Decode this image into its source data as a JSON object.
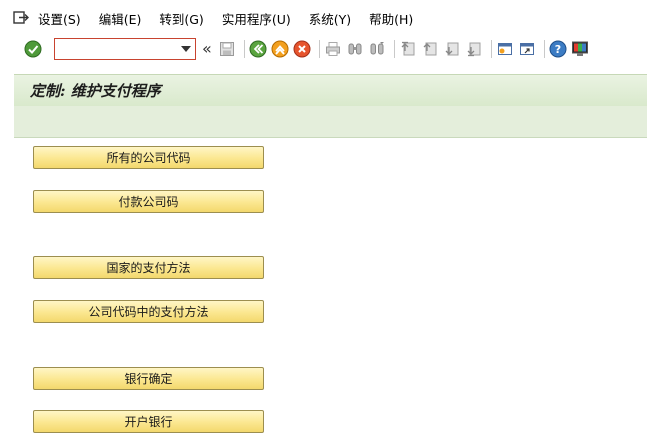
{
  "menu": {
    "items": [
      {
        "label": "设置(S)"
      },
      {
        "label": "编辑(E)"
      },
      {
        "label": "转到(G)"
      },
      {
        "label": "实用程序(U)"
      },
      {
        "label": "系统(Y)"
      },
      {
        "label": "帮助(H)"
      }
    ]
  },
  "toolbar": {
    "command_value": "",
    "icons": [
      "enter-check-icon",
      "command-dropdown-icon",
      "double-chevron-left-icon",
      "save-icon",
      "back-icon",
      "exit-icon",
      "cancel-icon",
      "print-icon",
      "find-icon",
      "find-next-icon",
      "first-page-icon",
      "previous-page-icon",
      "next-page-icon",
      "last-page-icon",
      "create-session-icon",
      "shortcut-icon",
      "help-icon",
      "customize-layout-icon"
    ]
  },
  "title": "定制: 维护支付程序",
  "buttons": [
    {
      "label": "所有的公司代码"
    },
    {
      "label": "付款公司码"
    },
    {
      "label": "国家的支付方法"
    },
    {
      "label": "公司代码中的支付方法"
    },
    {
      "label": "银行确定"
    },
    {
      "label": "开户银行"
    }
  ],
  "colors": {
    "title_bg": "#e4eedb",
    "button_bg": "#fbe790",
    "command_border": "#c8432f"
  }
}
